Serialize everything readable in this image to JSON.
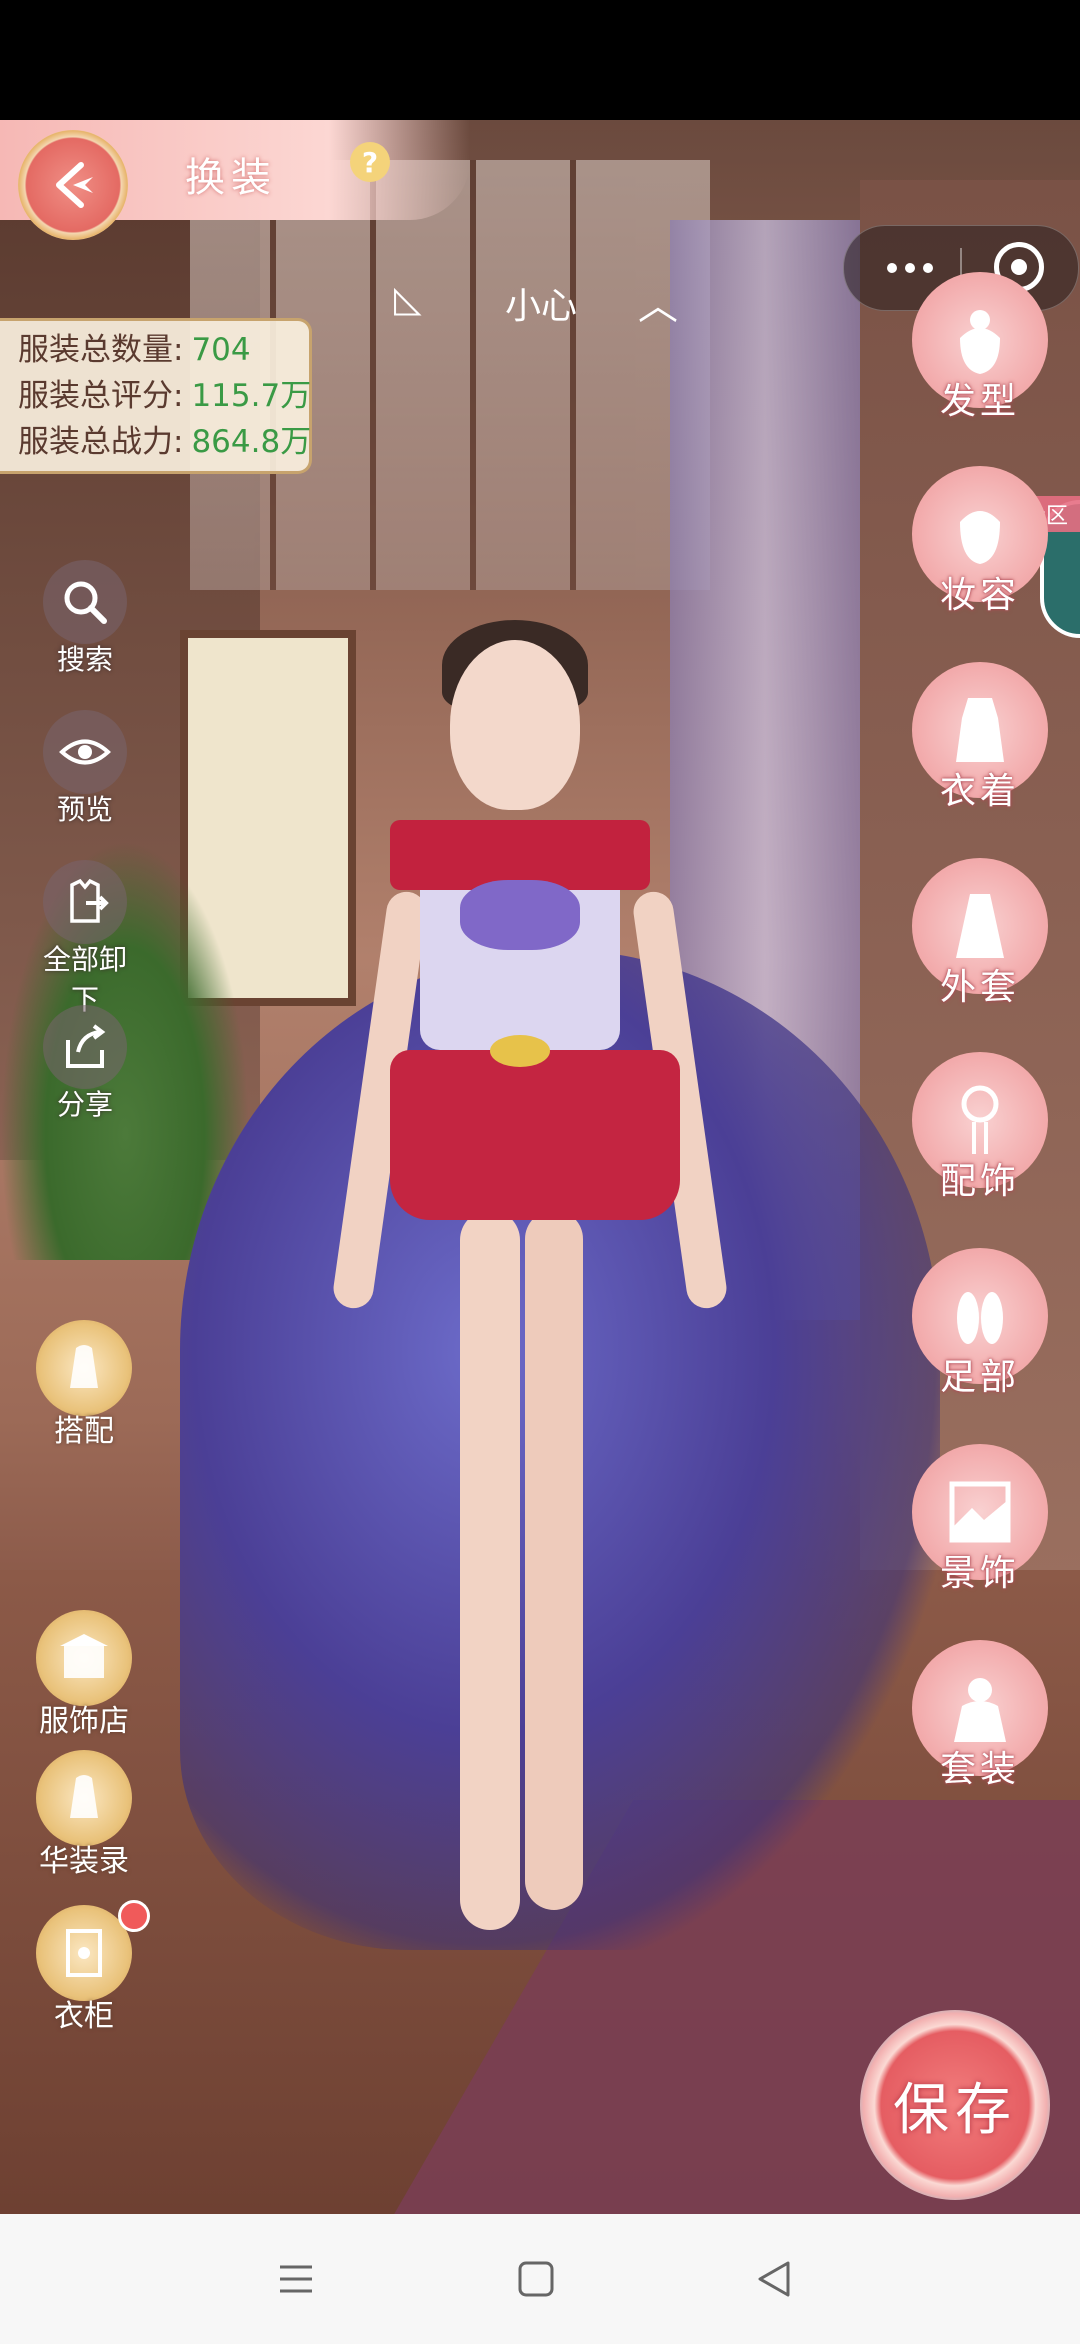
{
  "header": {
    "title": "换装",
    "help_icon": "?"
  },
  "stats": [
    {
      "label": "服装总数量:",
      "value": "704"
    },
    {
      "label": "服装总评分:",
      "value": "115.7万"
    },
    {
      "label": "服装总战力:",
      "value": "864.8万"
    }
  ],
  "character": {
    "name": "小心"
  },
  "left_tools": [
    {
      "label": "搜索",
      "icon": "search-icon"
    },
    {
      "label": "预览",
      "icon": "eye-icon"
    },
    {
      "label": "全部卸下",
      "icon": "undress-icon"
    },
    {
      "label": "分享",
      "icon": "share-icon"
    }
  ],
  "left_gold_tools": [
    {
      "label": "搭配",
      "icon": "outfit-icon"
    },
    {
      "label": "服饰店",
      "icon": "shop-icon"
    },
    {
      "label": "华装录",
      "icon": "collection-icon"
    },
    {
      "label": "衣柜",
      "icon": "wardrobe-icon"
    }
  ],
  "right_categories": [
    {
      "label": "发型",
      "icon": "hairstyle-icon"
    },
    {
      "label": "妆容",
      "icon": "makeup-icon"
    },
    {
      "label": "衣着",
      "icon": "clothing-icon"
    },
    {
      "label": "外套",
      "icon": "coat-icon"
    },
    {
      "label": "配饰",
      "icon": "accessory-icon"
    },
    {
      "label": "足部",
      "icon": "shoes-icon"
    },
    {
      "label": "景饰",
      "icon": "scene-icon"
    },
    {
      "label": "套装",
      "icon": "suit-icon"
    }
  ],
  "community_label": "社区",
  "save_label": "保存",
  "colors": {
    "accent": "#e55d62",
    "stat_value": "#3a9a45",
    "category_bg": "#f2a9aa"
  }
}
